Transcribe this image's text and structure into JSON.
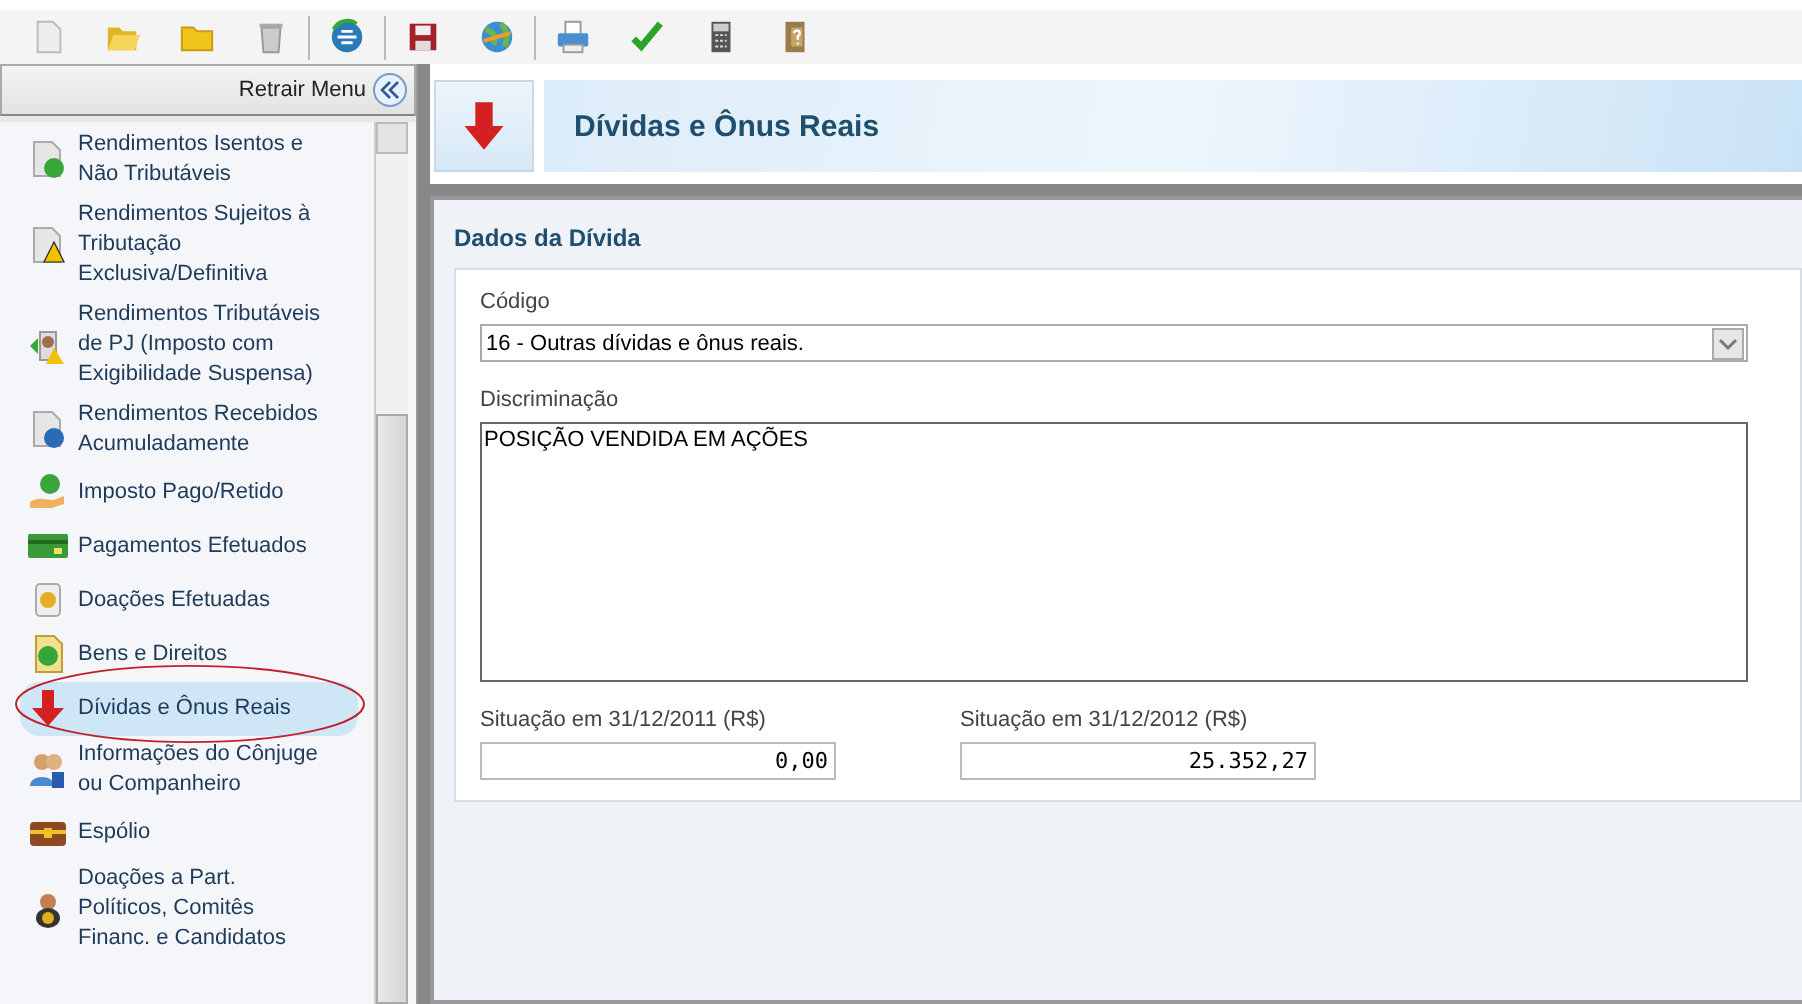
{
  "toolbar": [
    {
      "kind": "new"
    },
    {
      "kind": "open"
    },
    {
      "kind": "folder"
    },
    {
      "kind": "trash"
    },
    {
      "kind": "sep"
    },
    {
      "kind": "transmit"
    },
    {
      "kind": "sep"
    },
    {
      "kind": "save"
    },
    {
      "kind": "globe"
    },
    {
      "kind": "sep"
    },
    {
      "kind": "print"
    },
    {
      "kind": "check"
    },
    {
      "kind": "calc"
    },
    {
      "kind": "book"
    }
  ],
  "sidebar": {
    "collapse_label": "Retrair Menu",
    "items": [
      {
        "kind": "doc-check",
        "lines": [
          "Rendimentos Isentos e",
          "Não Tributáveis"
        ],
        "selected": false
      },
      {
        "kind": "doc-warn",
        "lines": [
          "Rendimentos Sujeitos à",
          "Tributação",
          "Exclusiva/Definitiva"
        ],
        "selected": false
      },
      {
        "kind": "person-warn",
        "lines": [
          "Rendimentos Tributáveis",
          "de PJ (Imposto com",
          "Exigibilidade Suspensa)"
        ],
        "selected": false
      },
      {
        "kind": "doc-back",
        "lines": [
          "Rendimentos Recebidos",
          "Acumuladamente"
        ],
        "selected": false
      },
      {
        "kind": "hand-coin",
        "lines": [
          "Imposto Pago/Retido"
        ],
        "selected": false
      },
      {
        "kind": "card",
        "lines": [
          "Pagamentos Efetuados"
        ],
        "selected": false
      },
      {
        "kind": "jar",
        "lines": [
          "Doações Efetuadas"
        ],
        "selected": false
      },
      {
        "kind": "doc-coin",
        "lines": [
          "Bens e Direitos"
        ],
        "selected": false
      },
      {
        "kind": "arrow-down",
        "lines": [
          "Dívidas e Ônus Reais"
        ],
        "selected": true
      },
      {
        "kind": "people",
        "lines": [
          "Informações do Cônjuge",
          "ou Companheiro"
        ],
        "selected": false
      },
      {
        "kind": "chest",
        "lines": [
          "Espólio"
        ],
        "selected": false
      },
      {
        "kind": "bag",
        "lines": [
          "Doações a Part.",
          "Políticos, Comitês",
          "Financ. e Candidatos"
        ],
        "selected": false
      }
    ]
  },
  "page": {
    "title": "Dívidas e Ônus Reais",
    "section": "Dados da Dívida",
    "codigo": {
      "label": "Código",
      "value": "16 - Outras dívidas e ônus reais."
    },
    "discriminacao": {
      "label": "Discriminação",
      "value": "POSIÇÃO VENDIDA EM AÇÕES"
    },
    "situacoes": [
      {
        "label": "Situação em 31/12/2011 (R$)",
        "value": "0,00"
      },
      {
        "label": "Situação em 31/12/2012 (R$)",
        "value": "25.352,27"
      }
    ]
  }
}
